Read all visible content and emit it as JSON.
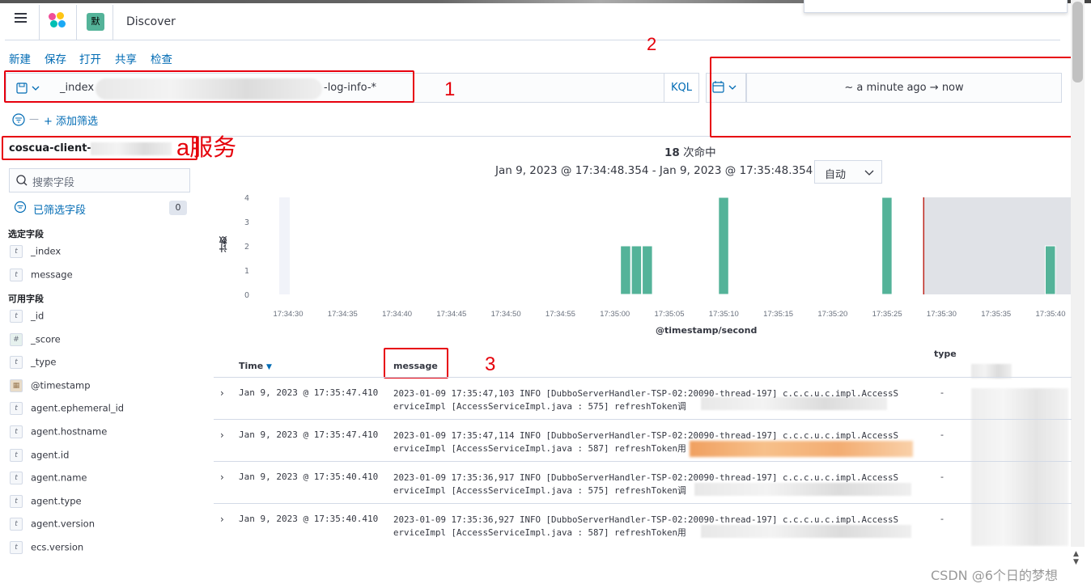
{
  "app": {
    "title": "Discover",
    "space_label": "默"
  },
  "menu": {
    "new": "新建",
    "save": "保存",
    "open": "打开",
    "share": "共享",
    "inspect": "检查"
  },
  "query": {
    "prefix": "_index",
    "suffix": "-log-info-*",
    "language": "KQL"
  },
  "time": {
    "start": "~ a minute ago",
    "arrow": "→",
    "end": "now"
  },
  "filter": {
    "add_label": "+ 添加筛选"
  },
  "sidebar": {
    "index_pattern": "coscua-client-",
    "search_placeholder": "搜索字段",
    "filtered_label": "已筛选字段",
    "filtered_count": "0",
    "selected_header": "选定字段",
    "selected_fields": [
      {
        "type": "t",
        "name": "_index"
      },
      {
        "type": "t",
        "name": "message"
      }
    ],
    "available_header": "可用字段",
    "available_fields": [
      {
        "type": "t",
        "name": "_id"
      },
      {
        "type": "#",
        "name": "_score"
      },
      {
        "type": "t",
        "name": "_type"
      },
      {
        "type": "cal",
        "name": "@timestamp"
      },
      {
        "type": "t",
        "name": "agent.ephemeral_id"
      },
      {
        "type": "t",
        "name": "agent.hostname"
      },
      {
        "type": "t",
        "name": "agent.id"
      },
      {
        "type": "t",
        "name": "agent.name"
      },
      {
        "type": "t",
        "name": "agent.type"
      },
      {
        "type": "t",
        "name": "agent.version"
      },
      {
        "type": "t",
        "name": "ecs.version"
      }
    ]
  },
  "hits": {
    "count": "18",
    "label": "次命中"
  },
  "range_label": "Jan 9, 2023 @ 17:34:48.354 - Jan 9, 2023 @ 17:35:48.354 —",
  "interval": "自动",
  "chart_data": {
    "type": "bar",
    "xlabel": "@timestamp/second",
    "ylabel": "计数",
    "ylim": [
      0,
      4
    ],
    "yticks": [
      "4",
      "3",
      "2",
      "1",
      "0"
    ],
    "xticks": [
      "17:34:30",
      "17:34:35",
      "17:34:40",
      "17:34:45",
      "17:34:50",
      "17:34:55",
      "17:35:00",
      "17:35:05",
      "17:35:10",
      "17:35:15",
      "17:35:20",
      "17:35:25",
      "17:35:30",
      "17:35:35",
      "17:35:40"
    ],
    "bars": [
      {
        "x": "17:35:01",
        "value": 2
      },
      {
        "x": "17:35:02",
        "value": 2
      },
      {
        "x": "17:35:03",
        "value": 2
      },
      {
        "x": "17:35:10",
        "value": 4
      },
      {
        "x": "17:35:25",
        "value": 4
      },
      {
        "x": "17:35:40",
        "value": 2
      }
    ],
    "colors": {
      "bar": "#54b399",
      "now_line": "#bd271e",
      "shade": "#e0e2e7"
    }
  },
  "table": {
    "col_time": "Time",
    "col_message": "message",
    "col_type": "type",
    "rows": [
      {
        "time": "Jan 9, 2023 @ 17:35:47.410",
        "line1": "2023-01-09 17:35:47,103 INFO [DubboServerHandler-TSP-02:20090-thread-197] c.c.c.u.c.impl.AccessS",
        "line2": "erviceImpl [AccessServiceImpl.java : 575] refreshToken调",
        "type": "-"
      },
      {
        "time": "Jan 9, 2023 @ 17:35:47.410",
        "line1": "2023-01-09 17:35:47,114 INFO [DubboServerHandler-TSP-02:20090-thread-197] c.c.c.u.c.impl.AccessS",
        "line2": "erviceImpl [AccessServiceImpl.java : 587] refreshToken用",
        "type": "-"
      },
      {
        "time": "Jan 9, 2023 @ 17:35:40.410",
        "line1": "2023-01-09 17:35:36,917 INFO [DubboServerHandler-TSP-02:20090-thread-197] c.c.c.u.c.impl.AccessS",
        "line2": "erviceImpl [AccessServiceImpl.java : 575] refreshToken调",
        "type": "-"
      },
      {
        "time": "Jan 9, 2023 @ 17:35:40.410",
        "line1": "2023-01-09 17:35:36,927 INFO [DubboServerHandler-TSP-02:20090-thread-197] c.c.c.u.c.impl.AccessS",
        "line2": "erviceImpl [AccessServiceImpl.java : 587] refreshToken用",
        "type": "-"
      }
    ]
  },
  "annotations": {
    "a1": "1",
    "a2": "2",
    "a3": "3",
    "service": "a服务"
  },
  "watermark": "CSDN @6个日的梦想"
}
